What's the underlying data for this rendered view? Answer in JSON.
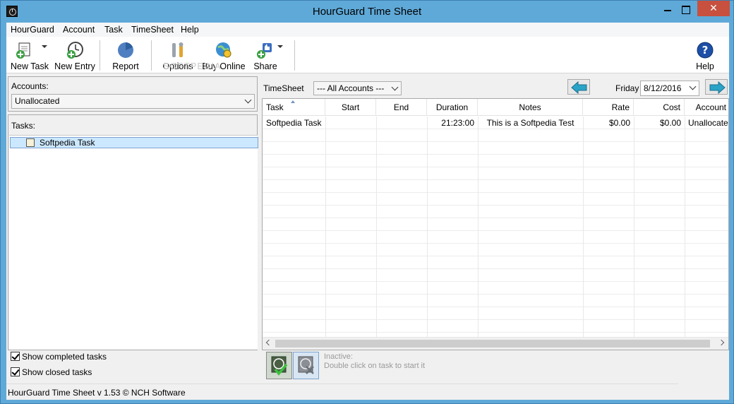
{
  "window": {
    "title": "HourGuard Time Sheet",
    "close_glyph": "✕"
  },
  "menu": [
    "HourGuard",
    "Account",
    "Task",
    "TimeSheet",
    "Help"
  ],
  "toolbar": {
    "new_task": "New Task",
    "new_entry": "New Entry",
    "report": "Report",
    "options": "Options",
    "buy_online": "Buy Online",
    "share": "Share",
    "help": "Help",
    "watermark": "SOFTPEDIA"
  },
  "left": {
    "accounts_label": "Accounts:",
    "accounts_value": "Unallocated",
    "tasks_label": "Tasks:",
    "tasks": [
      "Softpedia Task"
    ],
    "show_completed": "Show completed tasks",
    "show_closed": "Show closed tasks"
  },
  "timesheet": {
    "label": "TimeSheet",
    "account_filter": "--- All Accounts ---",
    "day": "Friday",
    "date": "8/12/2016",
    "columns": [
      "Task",
      "Start",
      "End",
      "Duration",
      "Notes",
      "Rate",
      "Cost",
      "Account"
    ],
    "rows": [
      [
        "Softpedia Task",
        "",
        "",
        "21:23:00",
        "This is a Softpedia Test",
        "$0.00",
        "$0.00",
        "Unallocated"
      ]
    ]
  },
  "status": {
    "inactive": "Inactive:",
    "hint": "Double click on task to start it",
    "bar": "HourGuard Time Sheet v 1.53 © NCH Software"
  },
  "colors": {
    "titlebar": "#5fa9d8",
    "close": "#c7503f",
    "selection": "#cce8ff",
    "arrow": "#2aa3c7"
  }
}
